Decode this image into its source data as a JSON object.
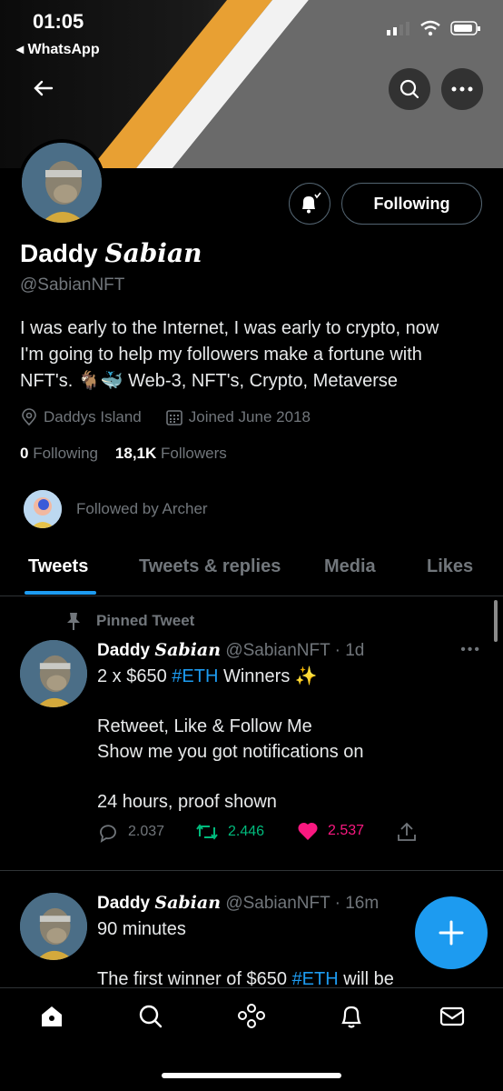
{
  "status_bar": {
    "time": "01:05",
    "back_app": "WhatsApp"
  },
  "profile": {
    "name_prefix": "Daddy ",
    "name_styled": "Sabian",
    "handle": "@SabianNFT",
    "bio_line1": "I was early to the Internet, I was early to crypto, now",
    "bio_line2": "I'm going to help my followers make a fortune with",
    "bio_line3": "NFT's. 🐐🐳 Web-3, NFT's, Crypto, Metaverse",
    "location": "Daddys Island",
    "joined": "Joined June 2018",
    "following_count": "0",
    "following_label": "Following",
    "followers_count": "18,1K",
    "followers_label": "Followers",
    "followed_by": "Followed by Archer",
    "following_button": "Following"
  },
  "tabs": [
    "Tweets",
    "Tweets & replies",
    "Media",
    "Likes"
  ],
  "tweets": [
    {
      "pinned_label": "Pinned Tweet",
      "name_prefix": "Daddy ",
      "name_styled": "Sabian",
      "meta": "@SabianNFT · 1d",
      "line1_pre": "2 x $650 ",
      "line1_hash": "#ETH",
      "line1_post": " Winners ✨",
      "line2": "Retweet, Like & Follow Me",
      "line3": "Show me you got notifications on",
      "line4": "24 hours, proof shown",
      "replies": "2.037",
      "retweets": "2.446",
      "likes": "2.537"
    },
    {
      "name_prefix": "Daddy ",
      "name_styled": "Sabian",
      "meta": "@SabianNFT · 16m",
      "line1": "90 minutes",
      "line2_pre": "The first winner of $650 ",
      "line2_hash": "#ETH",
      "line2_post": " will be"
    }
  ],
  "colors": {
    "accent": "#1d9bf0",
    "retweet": "#00ba7c",
    "like": "#f91880",
    "muted": "#71767b"
  },
  "icons": [
    "back-arrow-icon",
    "search-icon",
    "more-icon",
    "bell-plus-icon",
    "location-icon",
    "calendar-icon",
    "pin-icon",
    "reply-icon",
    "retweet-icon",
    "heart-icon",
    "share-icon",
    "compose-plus-icon",
    "home-icon",
    "explore-icon",
    "spaces-icon",
    "notifications-icon",
    "messages-icon"
  ]
}
